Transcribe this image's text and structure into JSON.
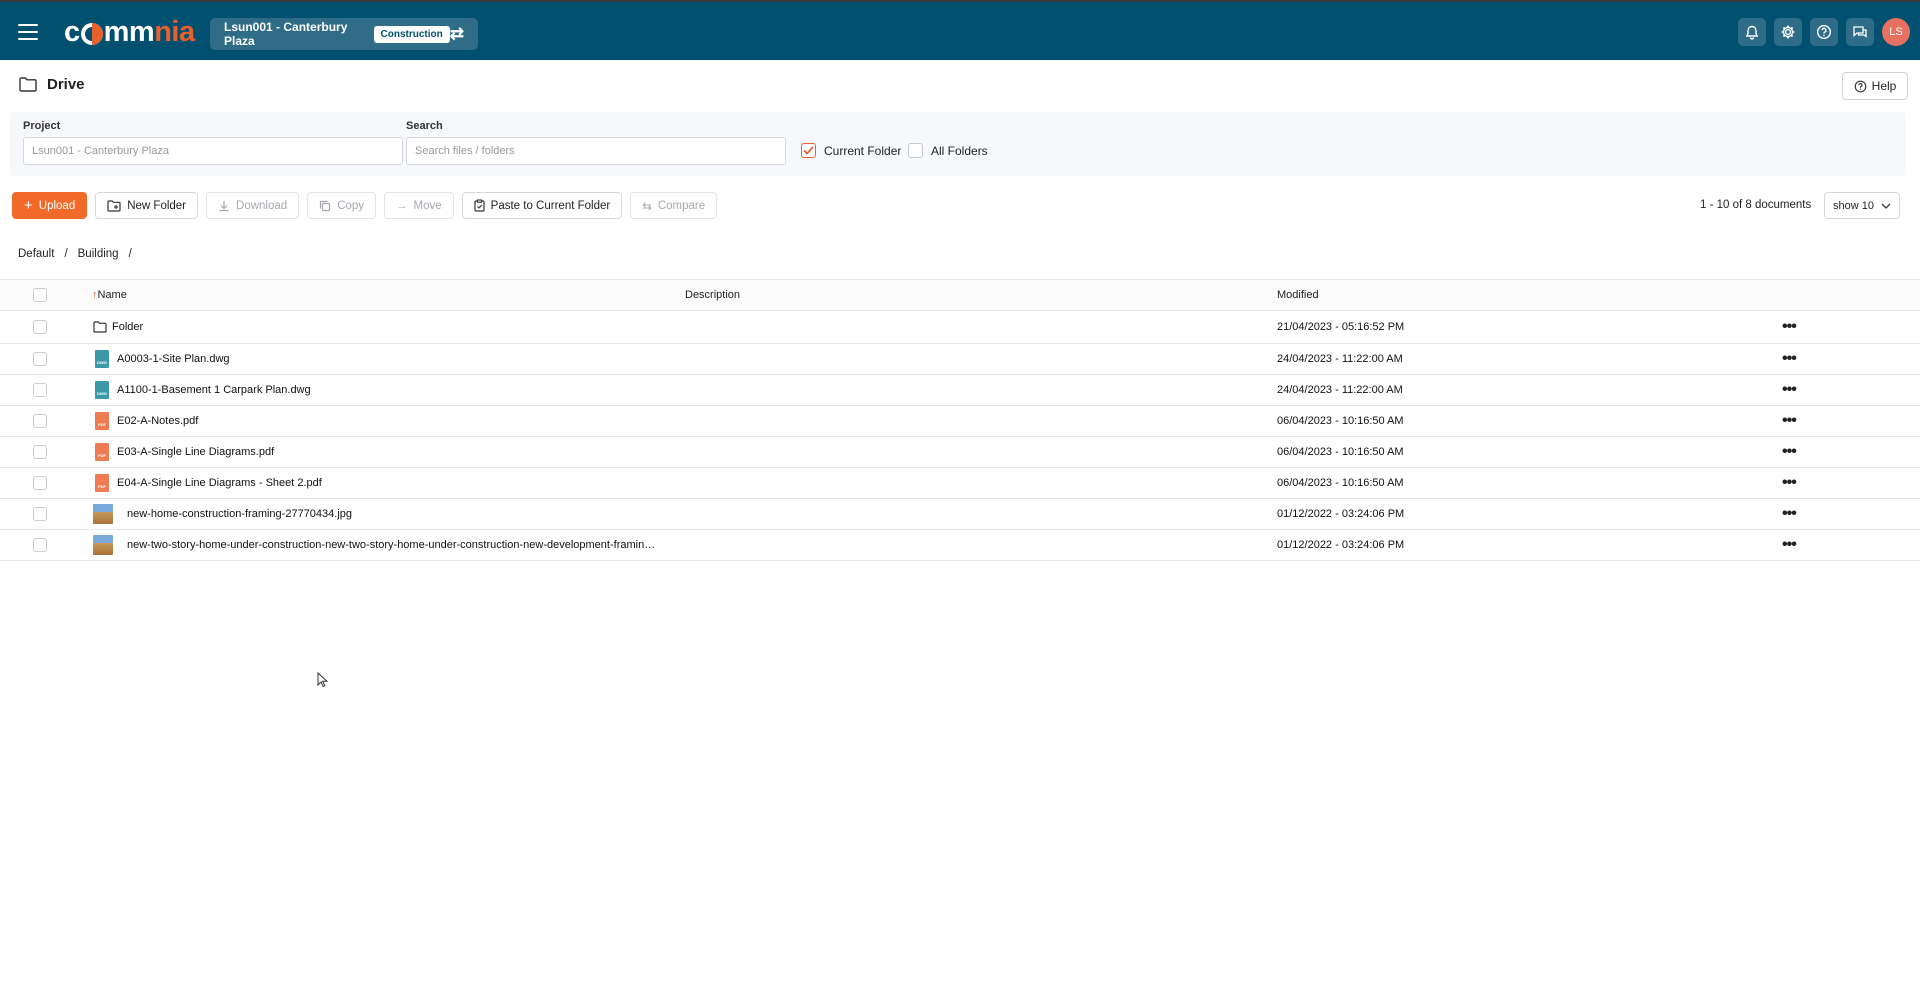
{
  "header": {
    "logo_text_white": "c",
    "logo_text_mid": "mm",
    "logo_text_accent": "nia",
    "project_name": "Lsun001 - Canterbury Plaza",
    "project_badge": "Construction",
    "user_initials": "LS",
    "brand_color": "#02506f",
    "accent_color": "#f26a2a",
    "icons": [
      "bell-icon",
      "gear-icon",
      "help-circle-icon",
      "chat-icon"
    ]
  },
  "page": {
    "title": "Drive",
    "help_label": "Help"
  },
  "filters": {
    "project_label": "Project",
    "project_value": "Lsun001 - Canterbury Plaza",
    "search_label": "Search",
    "search_placeholder": "Search files / folders",
    "current_folder_label": "Current Folder",
    "current_folder_checked": true,
    "all_folders_label": "All Folders",
    "all_folders_checked": false
  },
  "toolbar": {
    "upload": "Upload",
    "new_folder": "New Folder",
    "download": "Download",
    "copy": "Copy",
    "move": "Move",
    "paste": "Paste to Current Folder",
    "compare": "Compare",
    "doc_count": "1 - 10 of 8 documents",
    "show": "show 10"
  },
  "breadcrumb": [
    "Default",
    "Building"
  ],
  "table": {
    "headers": {
      "name": "Name",
      "description": "Description",
      "modified": "Modified"
    },
    "rows": [
      {
        "type": "folder",
        "name": "Folder",
        "description": "",
        "modified": "21/04/2023 - 05:16:52 PM"
      },
      {
        "type": "dwg",
        "name": "A0003-1-Site Plan.dwg",
        "description": "",
        "modified": "24/04/2023 - 11:22:00 AM"
      },
      {
        "type": "dwg",
        "name": "A1100-1-Basement 1 Carpark Plan.dwg",
        "description": "",
        "modified": "24/04/2023 - 11:22:00 AM"
      },
      {
        "type": "pdf",
        "name": "E02-A-Notes.pdf",
        "description": "",
        "modified": "06/04/2023 - 10:16:50 AM"
      },
      {
        "type": "pdf",
        "name": "E03-A-Single Line Diagrams.pdf",
        "description": "",
        "modified": "06/04/2023 - 10:16:50 AM"
      },
      {
        "type": "pdf",
        "name": "E04-A-Single Line Diagrams - Sheet 2.pdf",
        "description": "",
        "modified": "06/04/2023 - 10:16:50 AM"
      },
      {
        "type": "image",
        "name": "new-home-construction-framing-27770434.jpg",
        "description": "",
        "modified": "01/12/2022 - 03:24:06 PM"
      },
      {
        "type": "image",
        "name": "new-two-story-home-under-construction-new-two-story-home-under-construction-new-development-framin…",
        "description": "",
        "modified": "01/12/2022 - 03:24:06 PM"
      }
    ]
  }
}
